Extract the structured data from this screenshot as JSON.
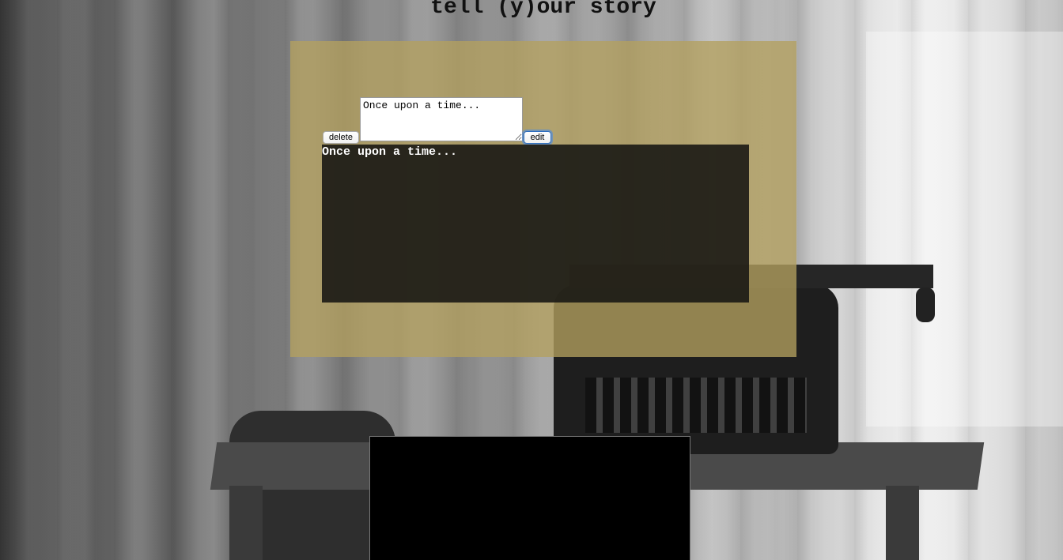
{
  "header": {
    "title": "tell (y)our story"
  },
  "editor": {
    "input_value": "Once upon a time...",
    "delete_label": "delete",
    "edit_label": "edit"
  },
  "story": {
    "text": "Once upon a time..."
  },
  "background": {
    "description_icon": "typewriter-photo"
  },
  "colors": {
    "panel": "#b4a05f",
    "story_bg": "#1a1814",
    "story_text": "#ffffff",
    "edit_focus": "#2f6fc0"
  }
}
